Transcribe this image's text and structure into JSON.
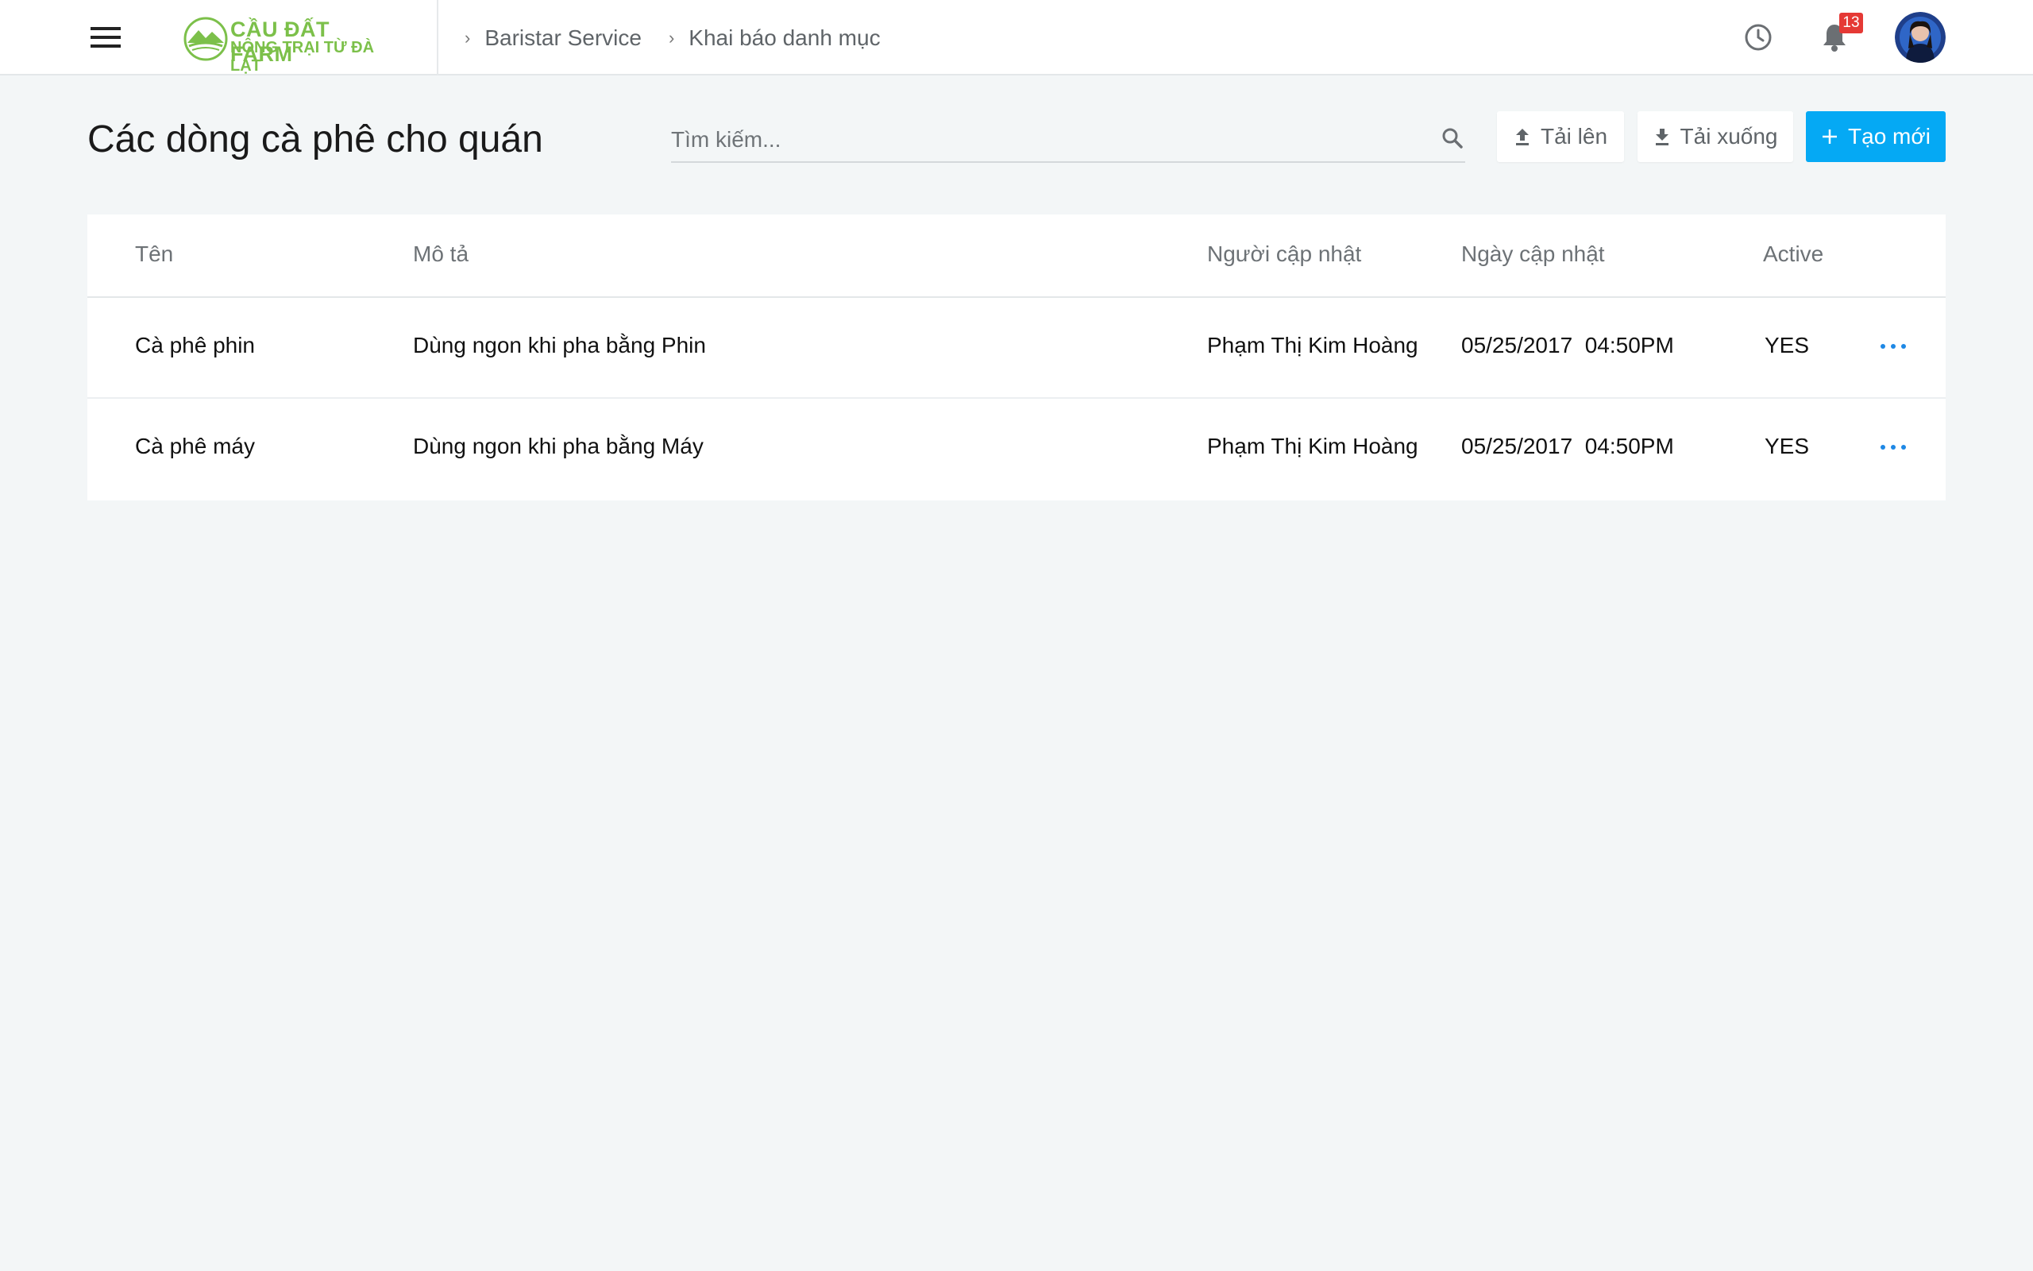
{
  "header": {
    "logo": {
      "line1": "CẦU ĐẤT FARM",
      "line2": "NÔNG TRẠI TỪ ĐÀ LẠT",
      "color": "#7cc04a"
    },
    "breadcrumb": [
      {
        "label": "Baristar Service"
      },
      {
        "label": "Khai báo danh mục"
      }
    ],
    "notifications": {
      "count": "13"
    }
  },
  "page": {
    "title": "Các dòng cà phê cho quán",
    "search": {
      "placeholder": "Tìm kiếm...",
      "value": ""
    },
    "buttons": {
      "upload": "Tải lên",
      "download": "Tải xuống",
      "create": "Tạo mới"
    },
    "accent_color": "#05a9f4"
  },
  "table": {
    "columns": {
      "name": "Tên",
      "description": "Mô tả",
      "updated_by": "Người cập nhật",
      "updated_at": "Ngày cập nhật",
      "active": "Active"
    },
    "rows": [
      {
        "name": "Cà phê phin",
        "description": "Dùng ngon khi pha bằng Phin",
        "updated_by": "Phạm Thị Kim Hoàng",
        "updated_at": "05/25/2017  04:50PM",
        "active": "YES"
      },
      {
        "name": "Cà phê máy",
        "description": "Dùng ngon khi pha bằng Máy",
        "updated_by": "Phạm Thị Kim Hoàng",
        "updated_at": "05/25/2017  04:50PM",
        "active": "YES"
      }
    ]
  },
  "icons": [
    "menu-icon",
    "clock-icon",
    "bell-icon",
    "search-icon",
    "upload-icon",
    "download-icon",
    "plus-icon",
    "more-horizontal-icon"
  ]
}
